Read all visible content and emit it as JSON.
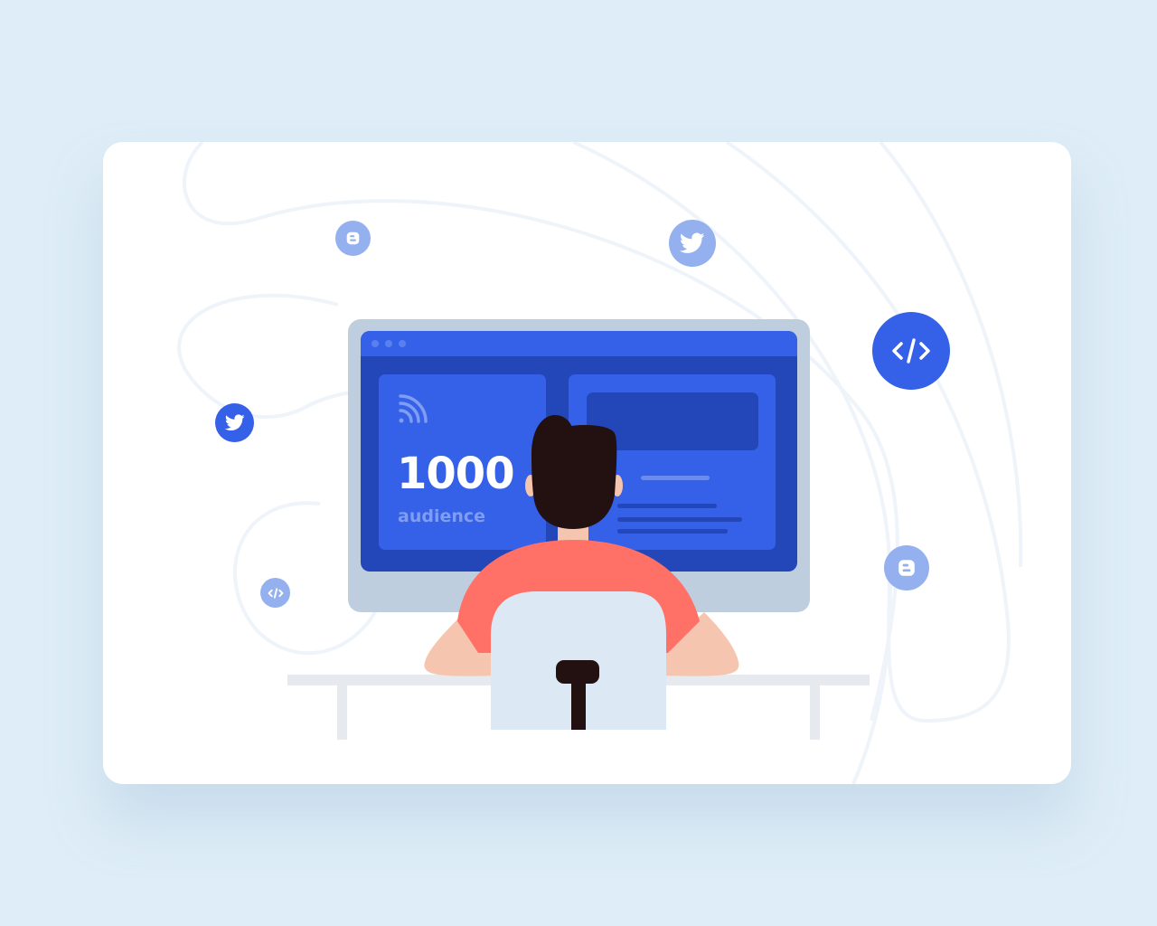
{
  "stat": {
    "value": "1000",
    "label": "audience"
  },
  "icons": {
    "blogger": "blogger-icon",
    "twitter": "twitter-icon",
    "code": "code-icon",
    "rss": "rss-icon"
  },
  "colors": {
    "background": "#DEEDF7",
    "card": "#FFFFFF",
    "accent": "#3560E8",
    "accent_dark": "#2347B8",
    "icon_light": "#94B0EE",
    "shirt": "#FF7066",
    "skin": "#F5C5B0",
    "hair": "#231010"
  }
}
